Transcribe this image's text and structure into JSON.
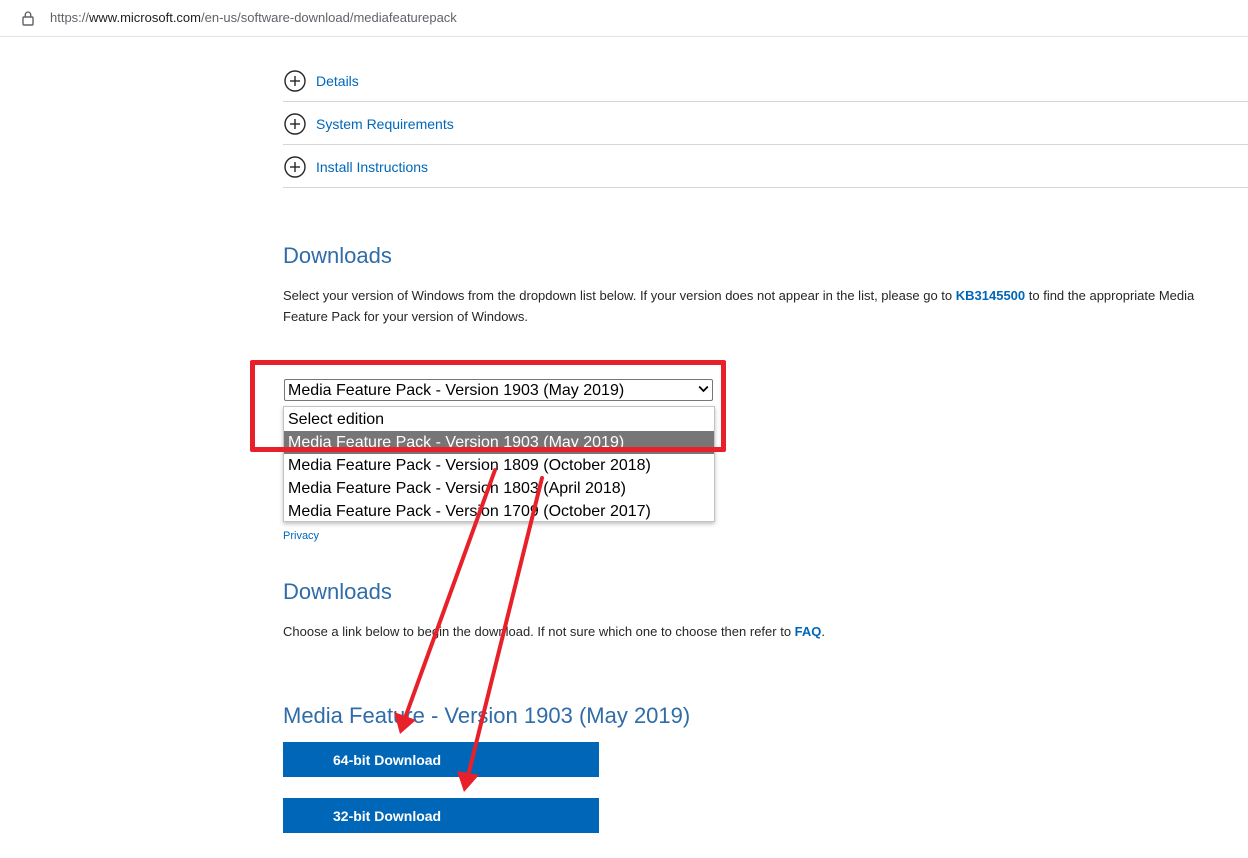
{
  "browser": {
    "url_prefix": "https://",
    "url_host": "www.microsoft.com",
    "url_path": "/en-us/software-download/mediafeaturepack"
  },
  "accordion": [
    {
      "label": "Details"
    },
    {
      "label": "System Requirements"
    },
    {
      "label": "Install Instructions"
    }
  ],
  "downloads_section": {
    "title": "Downloads",
    "text_before_link": "Select your version of Windows from the dropdown list below. If your version does not appear in the list, please go to ",
    "link_text": "KB3145500",
    "text_after_link": " to find the appropriate Media",
    "text_line2": "Feature Pack for your version of Windows."
  },
  "edition_select": {
    "selected_value": "Media Feature Pack - Version 1903 (May 2019)",
    "options": [
      {
        "label": "Select edition"
      },
      {
        "label": "Media Feature Pack - Version 1903 (May 2019)"
      },
      {
        "label": "Media Feature Pack - Version 1809 (October 2018)"
      },
      {
        "label": "Media Feature Pack - Version 1803 (April 2018)"
      },
      {
        "label": "Media Feature Pack - Version 1709 (October 2017)"
      }
    ],
    "highlighted_index": 1
  },
  "privacy_link": "Privacy",
  "downloads_section2": {
    "title": "Downloads",
    "text_before_link": "Choose a link below to begin the download. If not sure which one to choose then refer to ",
    "link_text": "FAQ",
    "text_after_link": "."
  },
  "product": {
    "title": "Media Feature - Version 1903 (May 2019)",
    "buttons": {
      "download_64": "64-bit Download",
      "download_32": "32-bit Download"
    }
  },
  "colors": {
    "link_blue": "#0067b8",
    "heading_blue": "#2f6ca8",
    "annotation_red": "#e8202a",
    "option_selected_bg": "#767676"
  }
}
